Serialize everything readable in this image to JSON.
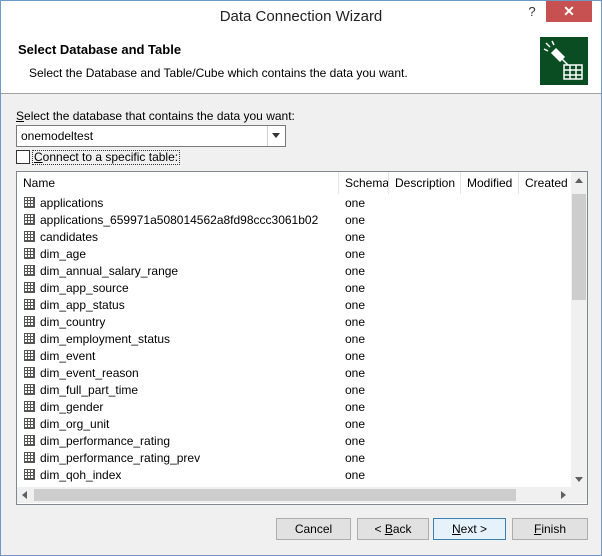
{
  "window": {
    "title": "Data Connection Wizard",
    "help_label": "?",
    "close_label": "✕"
  },
  "header": {
    "title": "Select Database and Table",
    "description": "Select the Database and Table/Cube which contains the data you want."
  },
  "database": {
    "label_first": "S",
    "label_rest": "elect the database that contains the data you want:",
    "selected": "onemodeltest"
  },
  "specific_table": {
    "label_first": "C",
    "label_rest": "onnect to a specific table:",
    "checked": false
  },
  "table_list": {
    "columns": [
      "Name",
      "Schema",
      "Description",
      "Modified",
      "Created"
    ],
    "rows": [
      {
        "name": "applications",
        "schema": "one"
      },
      {
        "name": "applications_659971a508014562a8fd98ccc3061b02",
        "schema": "one"
      },
      {
        "name": "candidates",
        "schema": "one"
      },
      {
        "name": "dim_age",
        "schema": "one"
      },
      {
        "name": "dim_annual_salary_range",
        "schema": "one"
      },
      {
        "name": "dim_app_source",
        "schema": "one"
      },
      {
        "name": "dim_app_status",
        "schema": "one"
      },
      {
        "name": "dim_country",
        "schema": "one"
      },
      {
        "name": "dim_employment_status",
        "schema": "one"
      },
      {
        "name": "dim_event",
        "schema": "one"
      },
      {
        "name": "dim_event_reason",
        "schema": "one"
      },
      {
        "name": "dim_full_part_time",
        "schema": "one"
      },
      {
        "name": "dim_gender",
        "schema": "one"
      },
      {
        "name": "dim_org_unit",
        "schema": "one"
      },
      {
        "name": "dim_performance_rating",
        "schema": "one"
      },
      {
        "name": "dim_performance_rating_prev",
        "schema": "one"
      },
      {
        "name": "dim_qoh_index",
        "schema": "one"
      }
    ]
  },
  "buttons": {
    "cancel": "Cancel",
    "back_prefix": "< ",
    "back_first": "B",
    "back_rest": "ack",
    "next_first": "N",
    "next_rest": "ext >",
    "finish_first": "F",
    "finish_rest": "inish"
  },
  "icons": {
    "wizard": "data-connection-wizard-icon",
    "table": "table-grid-icon"
  },
  "colors": {
    "close_button": "#c75050",
    "wizard_icon_bg": "#0b4d22",
    "primary_border": "#3c7fb1"
  }
}
